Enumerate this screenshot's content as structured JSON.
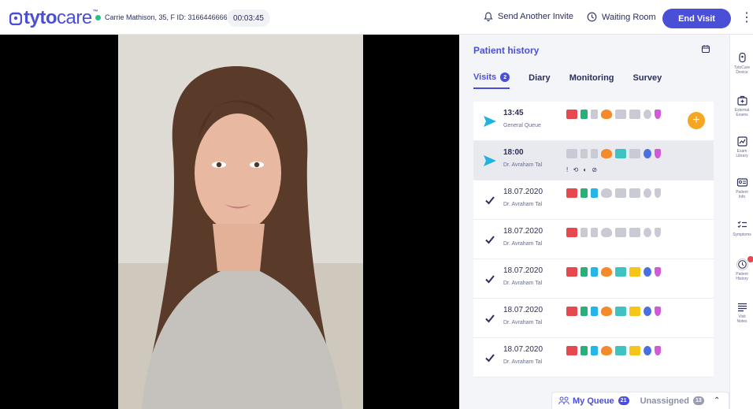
{
  "header": {
    "logo_text_bold": "tyto",
    "logo_text_light": "care",
    "logo_tm": "™",
    "patient_info": "Carrie Mathison, 35, F ID: 31664466666",
    "timer": "00:03:45",
    "send_invite_label": "Send Another Invite",
    "waiting_room_label": "Waiting Room",
    "end_visit_label": "End Visit",
    "more_label": "⋮"
  },
  "colors": {
    "brand": "#4a4fd8",
    "status_online": "#27c08a",
    "add_button": "#f5a623"
  },
  "history": {
    "title": "Patient history",
    "tabs": [
      {
        "label": "Visits",
        "count": "2",
        "active": true
      },
      {
        "label": "Diary"
      },
      {
        "label": "Monitoring"
      },
      {
        "label": "Survey"
      }
    ],
    "visits": [
      {
        "when": "13:45",
        "sub": "General Queue",
        "lead_icon": "send-arrow-icon",
        "exams_active": [
          true,
          true,
          false,
          true,
          false,
          false,
          false,
          true
        ],
        "extra": ""
      },
      {
        "when": "18:00",
        "sub": "Dr. Avraham Tal",
        "lead_icon": "send-arrow-icon",
        "exams_active": [
          false,
          false,
          false,
          true,
          true,
          false,
          true,
          true
        ],
        "extra": "! ⟲ ◐ ⊘"
      },
      {
        "when": "18.07.2020",
        "sub": "Dr. Avraham Tal",
        "lead_icon": "check-icon",
        "exams_active": [
          true,
          true,
          true,
          false,
          false,
          false,
          false,
          false
        ],
        "extra": ""
      },
      {
        "when": "18.07.2020",
        "sub": "Dr. Avraham Tal",
        "lead_icon": "check-icon",
        "exams_active": [
          true,
          false,
          false,
          false,
          false,
          false,
          false,
          false
        ],
        "extra": ""
      },
      {
        "when": "18.07.2020",
        "sub": "Dr. Avraham Tal",
        "lead_icon": "check-icon",
        "exams_active": [
          true,
          true,
          true,
          true,
          true,
          true,
          true,
          true
        ],
        "extra": ""
      },
      {
        "when": "18.07.2020",
        "sub": "Dr. Avraham Tal",
        "lead_icon": "check-icon",
        "exams_active": [
          true,
          true,
          true,
          true,
          true,
          true,
          true,
          true
        ],
        "extra": ""
      },
      {
        "when": "18.07.2020",
        "sub": "Dr. Avraham Tal",
        "lead_icon": "check-icon",
        "exams_active": [
          true,
          true,
          true,
          true,
          true,
          true,
          true,
          true
        ],
        "extra": ""
      }
    ],
    "add_label": "+"
  },
  "queue": {
    "my_queue_label": "My Queue",
    "my_queue_count": "21",
    "unassigned_label": "Unassigned",
    "unassigned_count": "13",
    "collapse_label": "⌃"
  },
  "rightnav": [
    {
      "label": "TytoCare\nDevice",
      "icon": "tytocare-device-icon"
    },
    {
      "label": "External\nExams",
      "icon": "external-exams-icon"
    },
    {
      "label": "Exam\nLibrary",
      "icon": "exam-library-icon"
    },
    {
      "label": "Patient\nInfo",
      "icon": "patient-info-icon"
    },
    {
      "label": "Symptoms",
      "icon": "symptoms-icon"
    },
    {
      "label": "Patient\nHistory",
      "icon": "patient-history-icon"
    },
    {
      "label": "Visit\nNotes",
      "icon": "visit-notes-icon"
    }
  ]
}
